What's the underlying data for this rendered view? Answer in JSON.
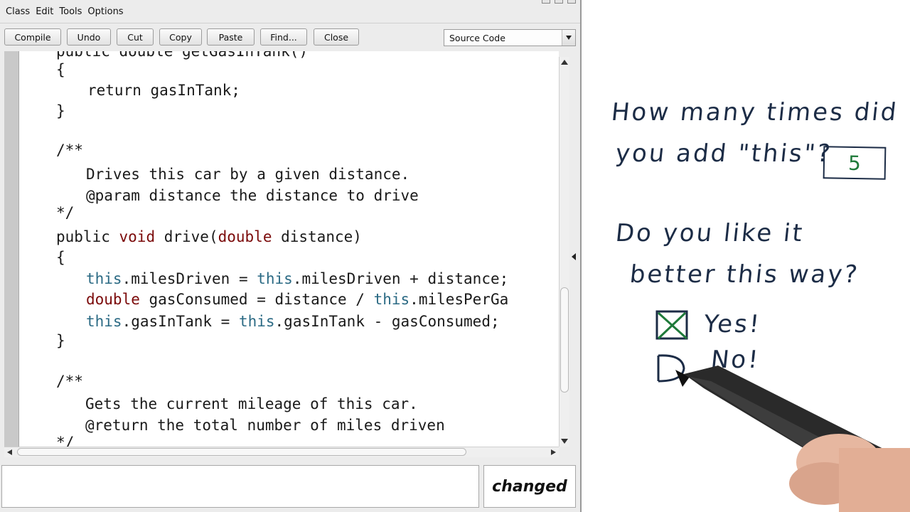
{
  "window": {
    "menu": [
      "Class",
      "Edit",
      "Tools",
      "Options"
    ],
    "toolbar": {
      "compile": "Compile",
      "undo": "Undo",
      "cut": "Cut",
      "copy": "Copy",
      "paste": "Paste",
      "find": "Find...",
      "close": "Close"
    },
    "view_select": "Source Code",
    "status": "changed",
    "message": ""
  },
  "code": {
    "line_1": "public double getGasInTank()",
    "line_2": "{",
    "line_3": "return gasInTank;",
    "line_4": "}",
    "line_5": "/**",
    "line_6": "Drives this car by a given distance.",
    "line_7": "@param distance the distance to drive",
    "line_8": "*/",
    "l9_a": "public ",
    "l9_b": "void",
    "l9_c": " drive(",
    "l9_d": "double",
    "l9_e": " distance)",
    "line_10": "{",
    "l11_a": "this",
    "l11_b": ".milesDriven = ",
    "l11_c": "this",
    "l11_d": ".milesDriven + distance;",
    "l12_a": "double",
    "l12_b": " gasConsumed = distance / ",
    "l12_c": "this",
    "l12_d": ".milesPerGa",
    "l13_a": "this",
    "l13_b": ".gasInTank = ",
    "l13_c": "this",
    "l13_d": ".gasInTank - gasConsumed;",
    "line_14": "}",
    "line_15": "/**",
    "line_16": "Gets the current mileage of this car.",
    "line_17": "@return the total number of miles driven",
    "line_18": "*/"
  },
  "board": {
    "q1_line1": "How many times did",
    "q1_line2": "you add \"this\"?",
    "q1_answer": "5",
    "q2_line1": "Do you like it",
    "q2_line2": "better this way?",
    "opt_yes": "Yes!",
    "opt_no": "No!",
    "colors": {
      "ink": "#1c2c46",
      "answer": "#1f7a3a"
    }
  }
}
